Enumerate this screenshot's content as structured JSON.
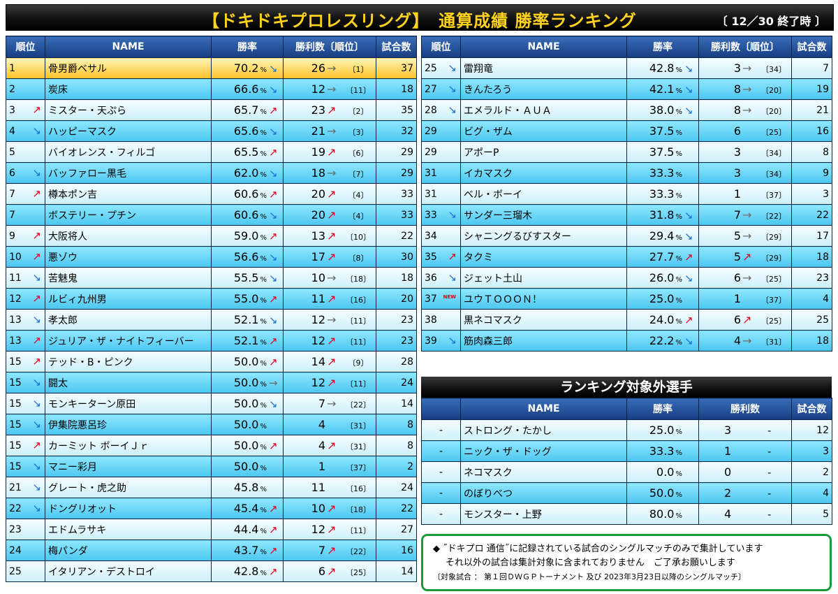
{
  "title": "【ドキドキプロレスリング】　通算成績 勝率ランキング",
  "date_label": "〔 12／30 終了時 〕",
  "headers": {
    "rank": "順位",
    "name": "NAME",
    "rate": "勝率",
    "wins": "勝利数〔順位〕",
    "games": "試合数"
  },
  "pct": "%",
  "colors": {
    "gold": "#ffc227",
    "cyan": "#4cc6ef",
    "pale": "#cdeff9",
    "header": "#173d82",
    "up": "#e3001b",
    "down": "#1b6dd1",
    "note_border": "#1b9a3c"
  },
  "arrow_glyphs": {
    "up": "↗",
    "down": "↘",
    "flat": "→",
    "none": ""
  },
  "new_badge": "NEW",
  "left_rows": [
    {
      "rank": "1",
      "rank_arrow": "none",
      "name": "骨男爵ベサル",
      "rate": "70.2",
      "rate_arrow": "down",
      "wins": "26",
      "wins_arrow": "flat",
      "win_rank": "〔1〕",
      "games": "37",
      "style": "gold"
    },
    {
      "rank": "2",
      "rank_arrow": "none",
      "name": "炭床",
      "rate": "66.6",
      "rate_arrow": "down",
      "wins": "12",
      "wins_arrow": "flat",
      "win_rank": "〔11〕",
      "games": "18",
      "style": "cyan"
    },
    {
      "rank": "3",
      "rank_arrow": "up",
      "name": "ミスター・天ぷら",
      "rate": "65.7",
      "rate_arrow": "up",
      "wins": "23",
      "wins_arrow": "up",
      "win_rank": "〔2〕",
      "games": "35",
      "style": "pale"
    },
    {
      "rank": "4",
      "rank_arrow": "down",
      "name": "ハッピーマスク",
      "rate": "65.6",
      "rate_arrow": "down",
      "wins": "21",
      "wins_arrow": "flat",
      "win_rank": "〔3〕",
      "games": "32",
      "style": "cyan"
    },
    {
      "rank": "5",
      "rank_arrow": "none",
      "name": "バイオレンス・フィルゴ",
      "rate": "65.5",
      "rate_arrow": "up",
      "wins": "19",
      "wins_arrow": "up",
      "win_rank": "〔6〕",
      "games": "29",
      "style": "pale"
    },
    {
      "rank": "6",
      "rank_arrow": "down",
      "name": "バッファロー黒毛",
      "rate": "62.0",
      "rate_arrow": "down",
      "wins": "18",
      "wins_arrow": "flat",
      "win_rank": "〔7〕",
      "games": "29",
      "style": "cyan"
    },
    {
      "rank": "7",
      "rank_arrow": "up",
      "name": "樽本ポン吉",
      "rate": "60.6",
      "rate_arrow": "up",
      "wins": "20",
      "wins_arrow": "up",
      "win_rank": "〔4〕",
      "games": "33",
      "style": "pale"
    },
    {
      "rank": "7",
      "rank_arrow": "none",
      "name": "ボステリー・プチン",
      "rate": "60.6",
      "rate_arrow": "down",
      "wins": "20",
      "wins_arrow": "up",
      "win_rank": "〔4〕",
      "games": "33",
      "style": "cyan"
    },
    {
      "rank": "9",
      "rank_arrow": "up",
      "name": "大阪将人",
      "rate": "59.0",
      "rate_arrow": "up",
      "wins": "13",
      "wins_arrow": "up",
      "win_rank": "〔10〕",
      "games": "22",
      "style": "pale"
    },
    {
      "rank": "10",
      "rank_arrow": "up",
      "name": "悪ゾウ",
      "rate": "56.6",
      "rate_arrow": "down",
      "wins": "17",
      "wins_arrow": "up",
      "win_rank": "〔8〕",
      "games": "30",
      "style": "cyan"
    },
    {
      "rank": "11",
      "rank_arrow": "down",
      "name": "苦魅鬼",
      "rate": "55.5",
      "rate_arrow": "down",
      "wins": "10",
      "wins_arrow": "flat",
      "win_rank": "〔18〕",
      "games": "18",
      "style": "pale"
    },
    {
      "rank": "12",
      "rank_arrow": "up",
      "name": "ルビィ九州男",
      "rate": "55.0",
      "rate_arrow": "up",
      "wins": "11",
      "wins_arrow": "up",
      "win_rank": "〔16〕",
      "games": "20",
      "style": "cyan"
    },
    {
      "rank": "13",
      "rank_arrow": "down",
      "name": "孝太郎",
      "rate": "52.1",
      "rate_arrow": "down",
      "wins": "12",
      "wins_arrow": "flat",
      "win_rank": "〔11〕",
      "games": "23",
      "style": "pale"
    },
    {
      "rank": "13",
      "rank_arrow": "up",
      "name": "ジュリア・ザ・ナイトフィーバー",
      "rate": "52.1",
      "rate_arrow": "up",
      "wins": "12",
      "wins_arrow": "up",
      "win_rank": "〔11〕",
      "games": "23",
      "style": "cyan"
    },
    {
      "rank": "15",
      "rank_arrow": "up",
      "name": "テッド・B・ピンク",
      "rate": "50.0",
      "rate_arrow": "up",
      "wins": "14",
      "wins_arrow": "up",
      "win_rank": "〔9〕",
      "games": "28",
      "style": "pale"
    },
    {
      "rank": "15",
      "rank_arrow": "down",
      "name": "闘太",
      "rate": "50.0",
      "rate_arrow": "flat",
      "wins": "12",
      "wins_arrow": "up",
      "win_rank": "〔11〕",
      "games": "24",
      "style": "cyan"
    },
    {
      "rank": "15",
      "rank_arrow": "down",
      "name": "モンキーターン原田",
      "rate": "50.0",
      "rate_arrow": "down",
      "wins": "7",
      "wins_arrow": "flat",
      "win_rank": "〔22〕",
      "games": "14",
      "style": "pale"
    },
    {
      "rank": "15",
      "rank_arrow": "down",
      "name": "伊集院悪呂珍",
      "rate": "50.0",
      "rate_arrow": "none",
      "wins": "4",
      "wins_arrow": "none",
      "win_rank": "〔31〕",
      "games": "8",
      "style": "cyan"
    },
    {
      "rank": "15",
      "rank_arrow": "up",
      "name": "カーミット ボーイＪｒ",
      "rate": "50.0",
      "rate_arrow": "up",
      "wins": "4",
      "wins_arrow": "up",
      "win_rank": "〔31〕",
      "games": "8",
      "style": "pale"
    },
    {
      "rank": "15",
      "rank_arrow": "down",
      "name": "マニー彩月",
      "rate": "50.0",
      "rate_arrow": "none",
      "wins": "1",
      "wins_arrow": "none",
      "win_rank": "〔37〕",
      "games": "2",
      "style": "cyan"
    },
    {
      "rank": "21",
      "rank_arrow": "down",
      "name": "グレート・虎之助",
      "rate": "45.8",
      "rate_arrow": "none",
      "wins": "11",
      "wins_arrow": "none",
      "win_rank": "〔16〕",
      "games": "24",
      "style": "pale"
    },
    {
      "rank": "22",
      "rank_arrow": "down",
      "name": "ドングリオット",
      "rate": "45.4",
      "rate_arrow": "up",
      "wins": "10",
      "wins_arrow": "up",
      "win_rank": "〔18〕",
      "games": "22",
      "style": "cyan"
    },
    {
      "rank": "23",
      "rank_arrow": "none",
      "name": "エドムラサキ",
      "rate": "44.4",
      "rate_arrow": "up",
      "wins": "12",
      "wins_arrow": "up",
      "win_rank": "〔11〕",
      "games": "27",
      "style": "pale"
    },
    {
      "rank": "24",
      "rank_arrow": "none",
      "name": "梅パンダ",
      "rate": "43.7",
      "rate_arrow": "up",
      "wins": "7",
      "wins_arrow": "up",
      "win_rank": "〔22〕",
      "games": "16",
      "style": "cyan"
    },
    {
      "rank": "25",
      "rank_arrow": "none",
      "name": "イタリアン・デストロイ",
      "rate": "42.8",
      "rate_arrow": "up",
      "wins": "6",
      "wins_arrow": "up",
      "win_rank": "〔25〕",
      "games": "14",
      "style": "pale"
    }
  ],
  "right_rows": [
    {
      "rank": "25",
      "rank_arrow": "down",
      "name": "雷翔竜",
      "rate": "42.8",
      "rate_arrow": "down",
      "wins": "3",
      "wins_arrow": "flat",
      "win_rank": "〔34〕",
      "games": "7",
      "style": "pale"
    },
    {
      "rank": "27",
      "rank_arrow": "down",
      "name": "きんたろう",
      "rate": "42.1",
      "rate_arrow": "down",
      "wins": "8",
      "wins_arrow": "flat",
      "win_rank": "〔20〕",
      "games": "19",
      "style": "cyan"
    },
    {
      "rank": "28",
      "rank_arrow": "down",
      "name": "エメラルド・ＡＵＡ",
      "rate": "38.0",
      "rate_arrow": "down",
      "wins": "8",
      "wins_arrow": "flat",
      "win_rank": "〔20〕",
      "games": "21",
      "style": "pale"
    },
    {
      "rank": "29",
      "rank_arrow": "none",
      "name": "ビグ・ザム",
      "rate": "37.5",
      "rate_arrow": "none",
      "wins": "6",
      "wins_arrow": "none",
      "win_rank": "〔25〕",
      "games": "16",
      "style": "cyan"
    },
    {
      "rank": "29",
      "rank_arrow": "none",
      "name": "アポーP",
      "rate": "37.5",
      "rate_arrow": "none",
      "wins": "3",
      "wins_arrow": "none",
      "win_rank": "〔34〕",
      "games": "8",
      "style": "pale"
    },
    {
      "rank": "31",
      "rank_arrow": "none",
      "name": "イカマスク",
      "rate": "33.3",
      "rate_arrow": "none",
      "wins": "3",
      "wins_arrow": "none",
      "win_rank": "〔34〕",
      "games": "9",
      "style": "cyan"
    },
    {
      "rank": "31",
      "rank_arrow": "none",
      "name": "ベル・ボーイ",
      "rate": "33.3",
      "rate_arrow": "none",
      "wins": "1",
      "wins_arrow": "none",
      "win_rank": "〔37〕",
      "games": "3",
      "style": "pale"
    },
    {
      "rank": "33",
      "rank_arrow": "down",
      "name": "サンダー三瑠木",
      "rate": "31.8",
      "rate_arrow": "down",
      "wins": "7",
      "wins_arrow": "flat",
      "win_rank": "〔22〕",
      "games": "22",
      "style": "cyan"
    },
    {
      "rank": "34",
      "rank_arrow": "none",
      "name": "シャニングるびすスター",
      "rate": "29.4",
      "rate_arrow": "down",
      "wins": "5",
      "wins_arrow": "flat",
      "win_rank": "〔29〕",
      "games": "17",
      "style": "pale"
    },
    {
      "rank": "35",
      "rank_arrow": "up",
      "name": "タクミ",
      "rate": "27.7",
      "rate_arrow": "up",
      "wins": "5",
      "wins_arrow": "up",
      "win_rank": "〔29〕",
      "games": "18",
      "style": "cyan"
    },
    {
      "rank": "36",
      "rank_arrow": "down",
      "name": "ジェット土山",
      "rate": "26.0",
      "rate_arrow": "down",
      "wins": "6",
      "wins_arrow": "flat",
      "win_rank": "〔25〕",
      "games": "23",
      "style": "pale"
    },
    {
      "rank": "37",
      "rank_arrow": "new",
      "name": "ユウＴＯＯＯＮ！",
      "rate": "25.0",
      "rate_arrow": "none",
      "wins": "1",
      "wins_arrow": "none",
      "win_rank": "〔37〕",
      "games": "4",
      "style": "cyan"
    },
    {
      "rank": "38",
      "rank_arrow": "none",
      "name": "黒ネコマスク",
      "rate": "24.0",
      "rate_arrow": "up",
      "wins": "6",
      "wins_arrow": "up",
      "win_rank": "〔25〕",
      "games": "25",
      "style": "pale"
    },
    {
      "rank": "39",
      "rank_arrow": "down",
      "name": "筋肉森三郎",
      "rate": "22.2",
      "rate_arrow": "down",
      "wins": "4",
      "wins_arrow": "flat",
      "win_rank": "〔31〕",
      "games": "18",
      "style": "cyan"
    }
  ],
  "excluded": {
    "title": "ランキング対象外選手",
    "headers": {
      "name": "NAME",
      "rate": "勝率",
      "wins": "勝利数",
      "games": "試合数"
    },
    "dash": "-",
    "rows": [
      {
        "name": "ストロング・たかし",
        "rate": "25.0",
        "wins": "3",
        "games": "12",
        "style": "pale"
      },
      {
        "name": "ニック・ザ・ドッグ",
        "rate": "33.3",
        "wins": "1",
        "games": "3",
        "style": "cyan"
      },
      {
        "name": "ネコマスク",
        "rate": "0.0",
        "wins": "0",
        "games": "2",
        "style": "pale"
      },
      {
        "name": "のぼりべつ",
        "rate": "50.0",
        "wins": "2",
        "games": "4",
        "style": "cyan"
      },
      {
        "name": "モンスター・上野",
        "rate": "80.0",
        "wins": "4",
        "games": "5",
        "style": "pale"
      }
    ]
  },
  "note": {
    "line1": "◆ ˝ドキプロ 通信˝に記録されている試合のシングルマッチのみで集計しています",
    "line2": "それ以外の試合は集計対象に含まれておりません　ご了承お願いします",
    "line3": "〔対象試合 ： 第１回ＤＷＧＰトーナメント 及び 2023年3月23日以降のシングルマッチ〕"
  }
}
